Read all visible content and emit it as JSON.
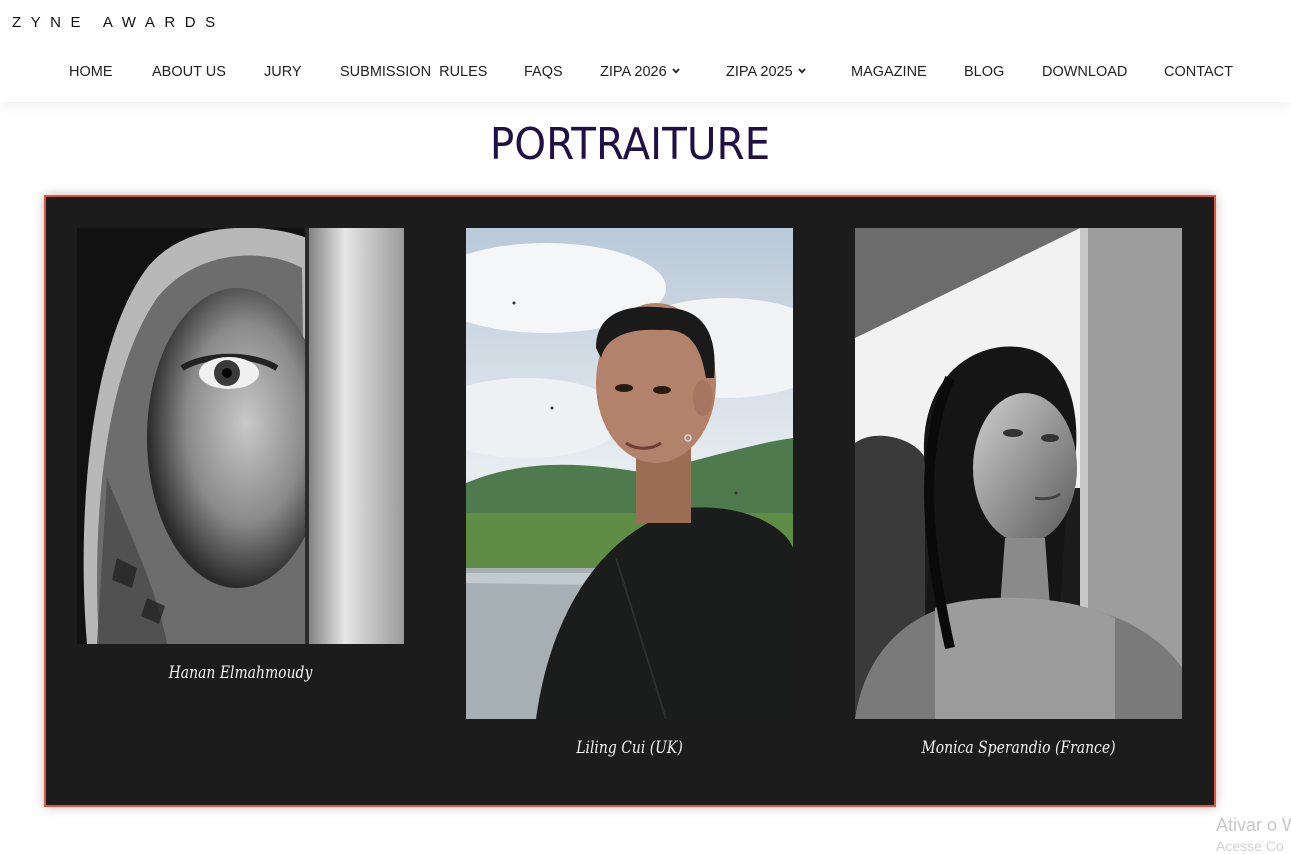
{
  "site": {
    "logo": "ZYNE AWARDS"
  },
  "nav": {
    "items": [
      {
        "label": "HOME"
      },
      {
        "label": "ABOUT US"
      },
      {
        "label": "JURY"
      },
      {
        "label": "SUBMISSION  RULES"
      },
      {
        "label": "FAQS"
      },
      {
        "label": "ZIPA 2026",
        "dropdown": true
      },
      {
        "label": "ZIPA 2025",
        "dropdown": true
      },
      {
        "label": "MAGAZINE"
      },
      {
        "label": "BLOG"
      },
      {
        "label": "DOWNLOAD"
      },
      {
        "label": "CONTACT"
      }
    ]
  },
  "page": {
    "title": "PORTRAITURE"
  },
  "gallery": {
    "border_color": "#e0533f",
    "background": "#1c1c1c",
    "items": [
      {
        "caption": "Hanan Elmahmoudy",
        "image": "portrait-headscarf-bw"
      },
      {
        "caption": "Liling Cui (UK)",
        "image": "portrait-young-man-color"
      },
      {
        "caption": "Monica Sperandio (France)",
        "image": "portrait-woman-bw"
      }
    ]
  },
  "system": {
    "watermark_line1": "Ativar o W",
    "watermark_line2": "Acesse Co"
  },
  "colors": {
    "title": "#1f1147",
    "accent_border": "#e0533f"
  }
}
